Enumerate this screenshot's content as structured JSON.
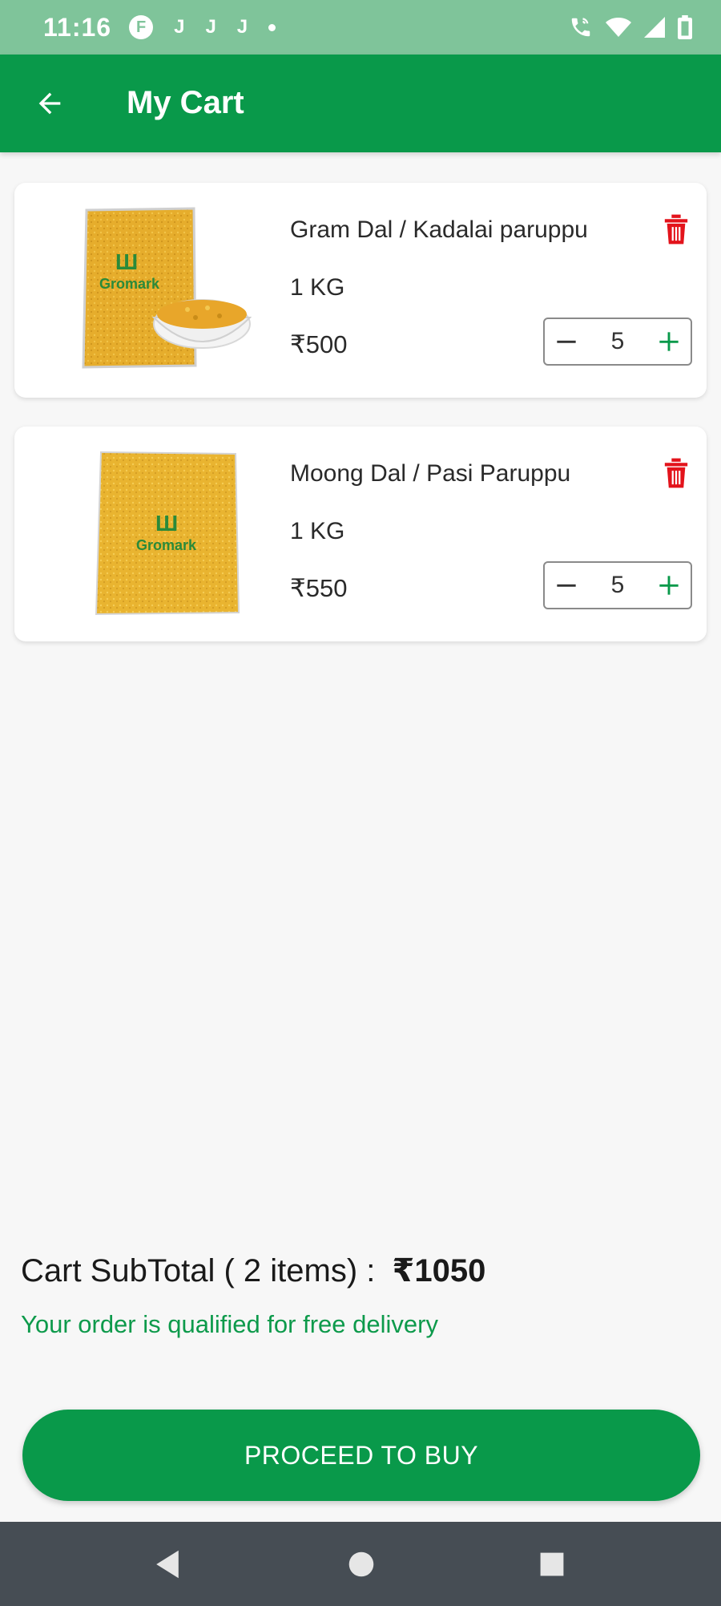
{
  "status_bar": {
    "time": "11:16",
    "notification_app_letter": "F",
    "notification_glyphs": [
      "J",
      "J",
      "J"
    ]
  },
  "app_bar": {
    "title": "My Cart"
  },
  "cart_items": [
    {
      "name": "Gram Dal / Kadalai paruppu",
      "unit": "1 KG",
      "price": "₹500",
      "quantity": "5",
      "brand": "Gromark"
    },
    {
      "name": "Moong Dal / Pasi Paruppu",
      "unit": "1 KG",
      "price": "₹550",
      "quantity": "5",
      "brand": "Gromark"
    }
  ],
  "summary": {
    "subtotal_label": "Cart SubTotal ( 2 items) :",
    "subtotal_amount": "₹1050",
    "delivery_note": "Your order is qualified for free delivery"
  },
  "actions": {
    "proceed_label": "PROCEED TO BUY"
  },
  "colors": {
    "primary": "#09994a",
    "status_bar": "#7fc49a",
    "delete": "#e3131b",
    "nav_bar": "#464d54"
  },
  "icons": {
    "back": "arrow-left-icon",
    "delete": "trash-icon",
    "minus": "minus-icon",
    "plus": "plus-icon"
  }
}
